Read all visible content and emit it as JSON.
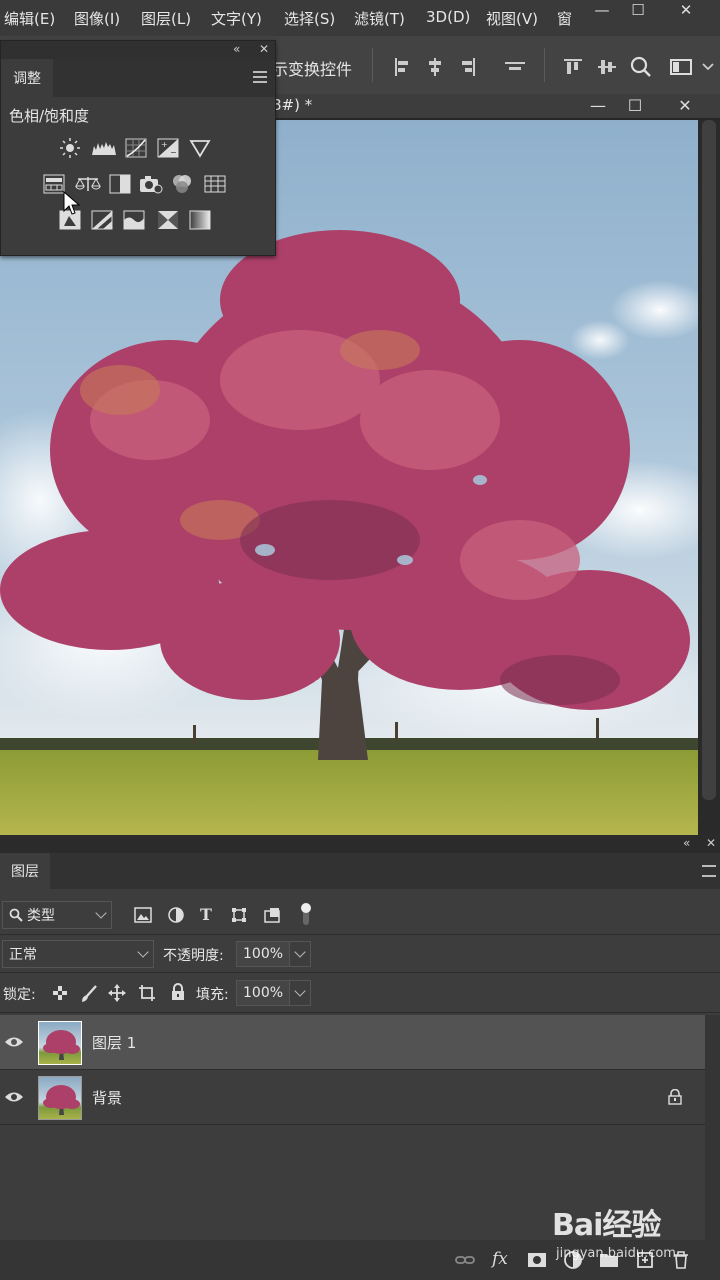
{
  "menu": [
    "编辑(E)",
    "图像(I)",
    "图层(L)",
    "文字(Y)",
    "选择(S)",
    "滤镜(T)",
    "3D(D)",
    "视图(V)",
    "窗"
  ],
  "window_controls": {
    "minimize": "—",
    "maximize": "☐",
    "close": "✕"
  },
  "options_bar": {
    "transform_controls_label": "示变换控件"
  },
  "document_tab": {
    "title": "8#) *",
    "minimize": "—",
    "maximize": "☐",
    "close": "✕"
  },
  "adjustments_panel": {
    "collapse": "«",
    "close": "✕",
    "tab": "调整",
    "hint": "色相/饱和度",
    "icons_row1": [
      "brightness-contrast-icon",
      "levels-icon",
      "curves-icon",
      "exposure-icon",
      "vibrance-icon"
    ],
    "icons_row2": [
      "hue-saturation-icon",
      "color-balance-icon",
      "black-white-icon",
      "photo-filter-icon",
      "channel-mixer-icon",
      "color-lookup-icon"
    ],
    "icons_row3": [
      "invert-icon",
      "posterize-icon",
      "threshold-icon",
      "selective-color-icon",
      "gradient-map-icon"
    ]
  },
  "layers_panel": {
    "collapse": "«",
    "close": "✕",
    "tab": "图层",
    "filter_kind": "类型",
    "blend_mode": "正常",
    "opacity_label": "不透明度:",
    "opacity_value": "100%",
    "lock_label": "锁定:",
    "fill_label": "填充:",
    "fill_value": "100%",
    "layers": [
      {
        "name": "图层 1",
        "selected": true,
        "visible": true,
        "locked": false
      },
      {
        "name": "背景",
        "selected": false,
        "visible": true,
        "locked": true
      }
    ]
  },
  "watermark": {
    "brand": "Bai经验",
    "url": "jingyan.baidu.com"
  },
  "colors": {
    "panel": "#3c3c3c",
    "dark": "#262626",
    "selected_row": "#535353",
    "text": "#dcdcdc",
    "foliage": "#b4456a",
    "grass": "#9aa83c",
    "sky": "#8fb0cc"
  }
}
